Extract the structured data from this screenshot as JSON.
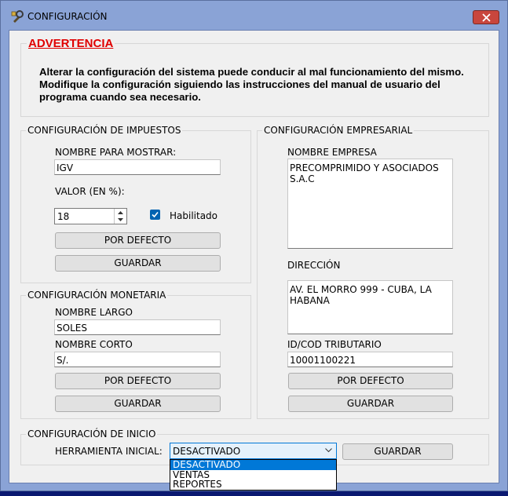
{
  "window": {
    "title": "CONFIGURACIÓN"
  },
  "warning": {
    "title": "ADVERTENCIA",
    "lines": [
      "Alterar la configuración del sistema puede conducir al mal funcionamiento del mismo.",
      "Modifique la configuración siguiendo las instrucciones del manual de usuario del",
      "programa cuando sea necesario."
    ]
  },
  "impuestos": {
    "group_title": "CONFIGURACIÓN DE IMPUESTOS",
    "display_name_label": "NOMBRE PARA MOSTRAR:",
    "display_name_value": "IGV",
    "value_label": "VALOR (EN %):",
    "value": "18",
    "enabled_label": "Habilitado",
    "enabled": true,
    "default_button": "POR DEFECTO",
    "save_button": "GUARDAR"
  },
  "monetaria": {
    "group_title": "CONFIGURACIÓN MONETARIA",
    "long_name_label": "NOMBRE LARGO",
    "long_name_value": "SOLES",
    "short_name_label": "NOMBRE CORTO",
    "short_name_value": "S/.",
    "default_button": "POR DEFECTO",
    "save_button": "GUARDAR"
  },
  "empresarial": {
    "group_title": "CONFIGURACIÓN EMPRESARIAL",
    "company_label": "NOMBRE EMPRESA",
    "company_value": "PRECOMPRIMIDO Y ASOCIADOS S.A.C",
    "address_label": "DIRECCIÓN",
    "address_value": "AV. EL MORRO 999 - CUBA, LA HABANA",
    "tax_id_label": "ID/COD TRIBUTARIO",
    "tax_id_value": "10001100221",
    "default_button": "POR DEFECTO",
    "save_button": "GUARDAR"
  },
  "inicio": {
    "group_title": "CONFIGURACIÓN DE INICIO",
    "tool_label": "HERRAMIENTA INICIAL:",
    "selected": "DESACTIVADO",
    "options": [
      "DESACTIVADO",
      "VENTAS",
      "REPORTES"
    ],
    "save_button": "GUARDAR"
  },
  "colors": {
    "warning_red": "#e00000",
    "accent": "#0078d7",
    "checkbox": "#0063b1"
  }
}
